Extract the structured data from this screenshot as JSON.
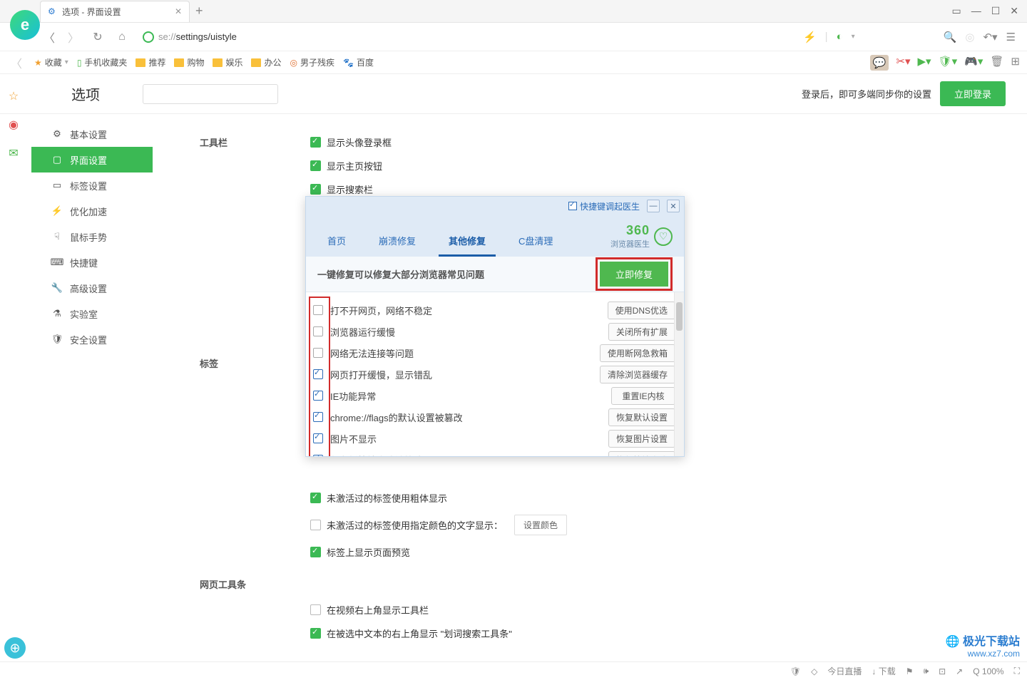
{
  "tab": {
    "title": "选项 - 界面设置"
  },
  "url": {
    "prefix": "se://",
    "path": "settings/uistyle"
  },
  "bookmarks": {
    "fav": "收藏",
    "items": [
      "手机收藏夹",
      "推荐",
      "购物",
      "娱乐",
      "办公",
      "男子残疾",
      "百度"
    ]
  },
  "settings": {
    "title": "选项",
    "login_hint": "登录后，即可多端同步你的设置",
    "login_btn": "立即登录",
    "sidebar": [
      {
        "label": "基本设置",
        "icon": "⚙"
      },
      {
        "label": "界面设置",
        "icon": "▢"
      },
      {
        "label": "标签设置",
        "icon": "▭"
      },
      {
        "label": "优化加速",
        "icon": "⚡"
      },
      {
        "label": "鼠标手势",
        "icon": "☟"
      },
      {
        "label": "快捷键",
        "icon": "⌨"
      },
      {
        "label": "高级设置",
        "icon": "🔧"
      },
      {
        "label": "实验室",
        "icon": "⚗"
      },
      {
        "label": "安全设置",
        "icon": "🛡"
      }
    ],
    "sections": {
      "toolbar": {
        "label": "工具栏",
        "opts": [
          {
            "text": "显示头像登录框",
            "checked": true
          },
          {
            "text": "显示主页按钮",
            "checked": true
          },
          {
            "text": "显示搜索栏",
            "checked": true
          }
        ]
      },
      "tabs": {
        "label": "标签",
        "opts": [
          {
            "text": "未激活过的标签使用粗体显示",
            "checked": true
          },
          {
            "text": "未激活过的标签使用指定颜色的文字显示：",
            "checked": false,
            "btn": "设置颜色"
          },
          {
            "text": "标签上显示页面预览",
            "checked": true
          }
        ]
      },
      "webbar": {
        "label": "网页工具条",
        "opts": [
          {
            "text": "在视频右上角显示工具栏",
            "checked": false
          },
          {
            "text": "在被选中文本的右上角显示 \"划词搜索工具条\"",
            "checked": true
          }
        ]
      }
    }
  },
  "doctor": {
    "shortcut_label": "快捷键调起医生",
    "brand_num": "360",
    "brand_text": "浏览器医生",
    "tabs": [
      "首页",
      "崩溃修复",
      "其他修复",
      "C盘清理"
    ],
    "active_tab": 2,
    "action_text": "一键修复可以修复大部分浏览器常见问题",
    "fix_btn": "立即修复",
    "items": [
      {
        "label": "打不开网页，网络不稳定",
        "checked": false,
        "btn": "使用DNS优选"
      },
      {
        "label": "浏览器运行缓慢",
        "checked": false,
        "btn": "关闭所有扩展"
      },
      {
        "label": "网络无法连接等问题",
        "checked": false,
        "btn": "使用断网急救箱"
      },
      {
        "label": "网页打开缓慢，显示错乱",
        "checked": true,
        "btn": "清除浏览器缓存"
      },
      {
        "label": "IE功能异常",
        "checked": true,
        "btn": "重置IE内核"
      },
      {
        "label": "chrome://flags的默认设置被篡改",
        "checked": true,
        "btn": "恢复默认设置"
      },
      {
        "label": "图片不显示",
        "checked": true,
        "btn": "恢复图片设置"
      },
      {
        "label": "任务栏快捷方式被篡改",
        "checked": true,
        "btn": "恢复快捷方式"
      }
    ]
  },
  "status": {
    "today": "今日直播",
    "download": "下载",
    "zoom": "100%"
  },
  "watermark": {
    "name": "极光下载站",
    "url": "www.xz7.com"
  }
}
